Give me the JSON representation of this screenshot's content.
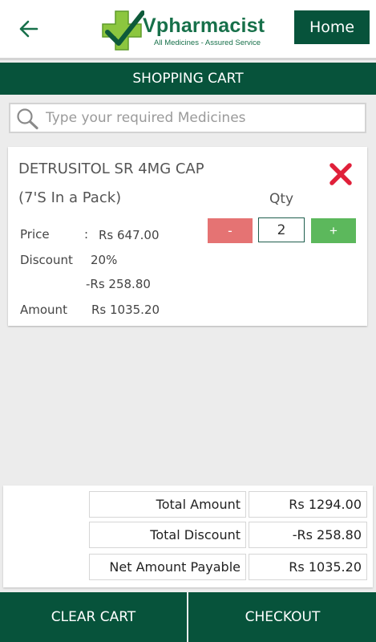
{
  "header": {
    "back_icon": "arrow-left-icon",
    "logo_name": "Vpharmacist",
    "logo_tagline": "All Medicines - Assured Service",
    "home_label": "Home"
  },
  "title": "SHOPPING CART",
  "search": {
    "icon": "search-icon",
    "placeholder": "Type your required Medicines",
    "value": ""
  },
  "cart_item": {
    "name": "DETRUSITOL SR 4MG CAP",
    "pack": "(7'S In a Pack)",
    "remove_icon": "close-x-icon",
    "qty_label": "Qty",
    "qty_minus": "-",
    "qty_value": "2",
    "qty_plus": "+",
    "price_label": "Price",
    "price_sep": ":",
    "price_value": "Rs  647.00",
    "discount_label": "Discount",
    "discount_percent": "20%",
    "discount_amount": "-Rs  258.80",
    "amount_label": "Amount",
    "amount_value": "Rs  1035.20"
  },
  "summary": {
    "total_amount_label": "Total Amount",
    "total_amount_value": "Rs  1294.00",
    "total_discount_label": "Total Discount",
    "total_discount_value": "-Rs   258.80",
    "net_payable_label": "Net Amount Payable",
    "net_payable_value": "Rs  1035.20"
  },
  "footer": {
    "clear_label": "CLEAR CART",
    "checkout_label": "CHECKOUT"
  },
  "colors": {
    "primary": "#07533b",
    "minus_button": "#e57373",
    "plus_button": "#5cb85c",
    "remove_icon": "#e0203a",
    "logo_green": "#17704a",
    "background": "#ececec"
  }
}
